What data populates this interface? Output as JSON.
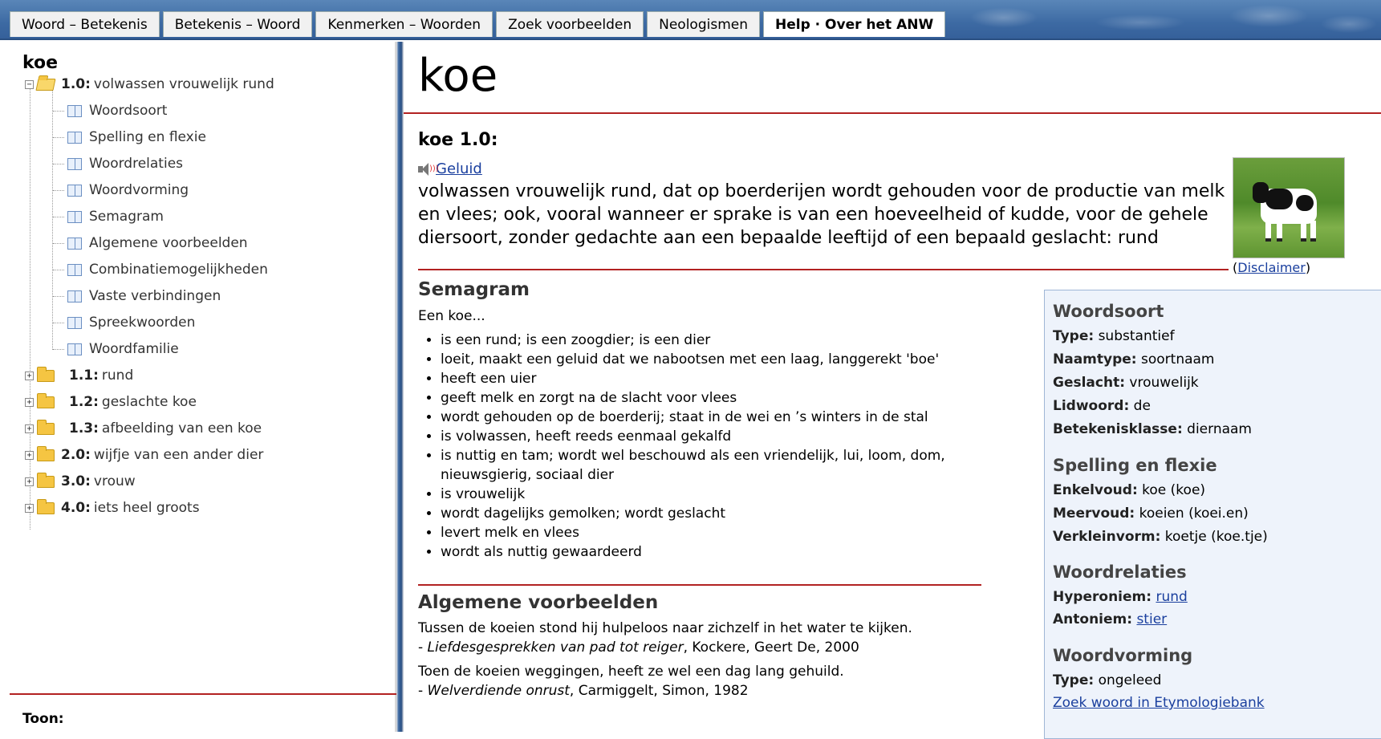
{
  "tabs": [
    {
      "label": "Woord – Betekenis"
    },
    {
      "label": "Betekenis – Woord"
    },
    {
      "label": "Kenmerken – Woorden"
    },
    {
      "label": "Zoek voorbeelden"
    },
    {
      "label": "Neologismen"
    },
    {
      "label": "Help · Over het ANW"
    }
  ],
  "tree": {
    "title": "koe",
    "root": {
      "num": "1.0:",
      "label": "volwassen vrouwelijk rund"
    },
    "children": [
      "Woordsoort",
      "Spelling en flexie",
      "Woordrelaties",
      "Woordvorming",
      "Semagram",
      "Algemene voorbeelden",
      "Combinatiemogelijkheden",
      "Vaste verbindingen",
      "Spreekwoorden",
      "Woordfamilie"
    ],
    "subsenses": [
      {
        "num": "1.1:",
        "label": "rund"
      },
      {
        "num": "1.2:",
        "label": "geslachte koe"
      },
      {
        "num": "1.3:",
        "label": "afbeelding van een koe"
      }
    ],
    "senses": [
      {
        "num": "2.0:",
        "label": "wijfje van een ander dier"
      },
      {
        "num": "3.0:",
        "label": "vrouw"
      },
      {
        "num": "4.0:",
        "label": "iets heel groots"
      }
    ],
    "toon": "Toon:"
  },
  "main": {
    "word": "koe",
    "sense_title": "koe 1.0:",
    "sound_label": "Geluid",
    "definition": "volwassen vrouwelijk rund, dat op boerderijen wordt gehouden voor de productie van melk en vlees; ook, vooral wanneer er sprake is van een hoeveelheid of kudde, voor de gehele diersoort, zonder gedachte aan een bepaalde leeftijd of een bepaald geslacht: rund",
    "disclaimer": "Disclaimer",
    "semagram": {
      "title": "Semagram",
      "intro": "Een koe...",
      "items": [
        "is een rund; is een zoogdier; is een dier",
        "loeit, maakt een geluid dat we nabootsen met een laag, langgerekt 'boe'",
        "heeft een uier",
        "geeft melk en zorgt na de slacht voor vlees",
        "wordt gehouden op de boerderij; staat in de wei en ’s winters in de stal",
        "is volwassen, heeft reeds eenmaal gekalfd",
        "is nuttig en tam; wordt wel beschouwd als een vriendelijk, lui, loom, dom, nieuwsgierig, sociaal dier",
        "is vrouwelijk",
        "wordt dagelijks gemolken; wordt geslacht",
        "levert melk en vlees",
        "wordt als nuttig gewaardeerd"
      ]
    },
    "examples": {
      "title": "Algemene voorbeelden",
      "items": [
        {
          "text": "Tussen de koeien stond hij hulpeloos naar zichzelf in het water te kijken.",
          "source_title": "Liefdesgesprekken van pad tot reiger",
          "source_rest": ", Kockere, Geert De, 2000"
        },
        {
          "text": "Toen de koeien weggingen, heeft ze wel een dag lang gehuild.",
          "source_title": "Welverdiende onrust",
          "source_rest": ", Carmiggelt, Simon, 1982"
        }
      ]
    }
  },
  "infobox": {
    "woordsoort": {
      "title": "Woordsoort",
      "type_label": "Type:",
      "type_value": "substantief",
      "naamtype_label": "Naamtype:",
      "naamtype_value": "soortnaam",
      "geslacht_label": "Geslacht:",
      "geslacht_value": "vrouwelijk",
      "lidwoord_label": "Lidwoord:",
      "lidwoord_value": "de",
      "betekenisklasse_label": "Betekenisklasse:",
      "betekenisklasse_value": "diernaam"
    },
    "spelling": {
      "title": "Spelling en flexie",
      "enkelvoud_label": "Enkelvoud:",
      "enkelvoud_value": "koe (koe)",
      "meervoud_label": "Meervoud:",
      "meervoud_value": "koeien (koei.en)",
      "verklein_label": "Verkleinvorm:",
      "verklein_value": "koetje (koe.tje)"
    },
    "relaties": {
      "title": "Woordrelaties",
      "hyper_label": "Hyperoniem:",
      "hyper_value": "rund",
      "anto_label": "Antoniem:",
      "anto_value": "stier"
    },
    "vorming": {
      "title": "Woordvorming",
      "type_label": "Type:",
      "type_value": "ongeleed",
      "etymo_link": "Zoek woord in Etymologiebank"
    }
  },
  "colors": {
    "accent_red": "#b22222",
    "header_blue": "#3d6aa3",
    "link": "#1a3f9e",
    "infobox_bg": "#eef3fb"
  }
}
